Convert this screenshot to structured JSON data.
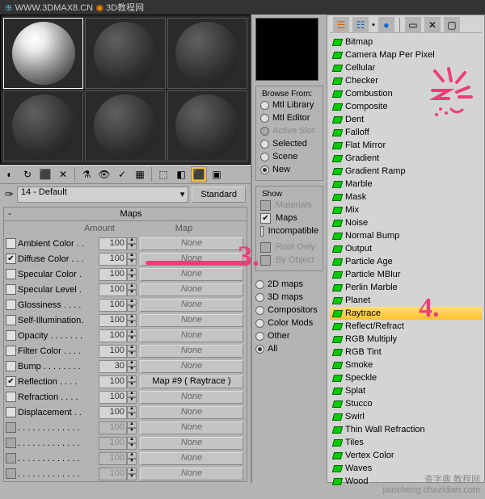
{
  "url_bar": {
    "domain": "WWW.3DMAX8.CN",
    "site_name": "3D教程网"
  },
  "toolbar_icons": [
    "◐",
    "↻",
    "⬛",
    "✕",
    "⚗",
    "👁",
    "✓",
    "▦",
    "⬚",
    "◧",
    "⬛",
    "▣"
  ],
  "material_picker": {
    "name": "14 - Default",
    "type_button": "Standard"
  },
  "maps_rollup": {
    "title": "Maps",
    "header_amount": "Amount",
    "header_map": "Map",
    "rows": [
      {
        "label": "Ambient Color . .",
        "amount": "100",
        "map": "None",
        "checked": false,
        "enabled": true
      },
      {
        "label": "Diffuse Color . . .",
        "amount": "100",
        "map": "None",
        "checked": true,
        "enabled": true
      },
      {
        "label": "Specular Color .",
        "amount": "100",
        "map": "None",
        "checked": false,
        "enabled": true
      },
      {
        "label": "Specular Level .",
        "amount": "100",
        "map": "None",
        "checked": false,
        "enabled": true
      },
      {
        "label": "Glossiness . . . .",
        "amount": "100",
        "map": "None",
        "checked": false,
        "enabled": true
      },
      {
        "label": "Self-Illumination.",
        "amount": "100",
        "map": "None",
        "checked": false,
        "enabled": true
      },
      {
        "label": "Opacity . . . . . . .",
        "amount": "100",
        "map": "None",
        "checked": false,
        "enabled": true
      },
      {
        "label": "Filter Color . . . .",
        "amount": "100",
        "map": "None",
        "checked": false,
        "enabled": true
      },
      {
        "label": "Bump . . . . . . . .",
        "amount": "30",
        "map": "None",
        "checked": false,
        "enabled": true
      },
      {
        "label": "Reflection . . . .",
        "amount": "100",
        "map": "Map #9 ( Raytrace )",
        "checked": true,
        "enabled": true
      },
      {
        "label": "Refraction . . . .",
        "amount": "100",
        "map": "None",
        "checked": false,
        "enabled": true
      },
      {
        "label": "Displacement . .",
        "amount": "100",
        "map": "None",
        "checked": false,
        "enabled": true
      },
      {
        "label": ". . . . . . . . . . . . .",
        "amount": "100",
        "map": "None",
        "checked": false,
        "enabled": false
      },
      {
        "label": ". . . . . . . . . . . . .",
        "amount": "100",
        "map": "None",
        "checked": false,
        "enabled": false
      },
      {
        "label": ". . . . . . . . . . . . .",
        "amount": "100",
        "map": "None",
        "checked": false,
        "enabled": false
      },
      {
        "label": ". . . . . . . . . . . . .",
        "amount": "100",
        "map": "None",
        "checked": false,
        "enabled": false
      }
    ]
  },
  "browse_from": {
    "legend": "Browse From:",
    "options": [
      {
        "label": "Mtl Library",
        "on": false,
        "dis": false
      },
      {
        "label": "Mtl Editor",
        "on": false,
        "dis": false
      },
      {
        "label": "Active Slot",
        "on": false,
        "dis": true
      },
      {
        "label": "Selected",
        "on": false,
        "dis": false
      },
      {
        "label": "Scene",
        "on": false,
        "dis": false
      },
      {
        "label": "New",
        "on": true,
        "dis": false
      }
    ]
  },
  "show": {
    "legend": "Show",
    "options": [
      {
        "label": "Materials",
        "dis": true
      },
      {
        "label": "Maps",
        "dis": false,
        "checked": true
      },
      {
        "label": "Incompatible",
        "dis": false
      }
    ],
    "options2": [
      {
        "label": "Root Only",
        "dis": true
      },
      {
        "label": "By Object",
        "dis": true
      }
    ]
  },
  "filter": {
    "options": [
      {
        "label": "2D maps",
        "on": false
      },
      {
        "label": "3D maps",
        "on": false
      },
      {
        "label": "Compositors",
        "on": false
      },
      {
        "label": "Color Mods",
        "on": false
      },
      {
        "label": "Other",
        "on": false
      },
      {
        "label": "All",
        "on": true
      }
    ]
  },
  "map_list": [
    "Bitmap",
    "Camera Map Per Pixel",
    "Cellular",
    "Checker",
    "Combustion",
    "Composite",
    "Dent",
    "Falloff",
    "Flat Mirror",
    "Gradient",
    "Gradient Ramp",
    "Marble",
    "Mask",
    "Mix",
    "Noise",
    "Normal Bump",
    "Output",
    "Particle Age",
    "Particle MBlur",
    "Perlin Marble",
    "Planet",
    "Raytrace",
    "Reflect/Refract",
    "RGB Multiply",
    "RGB Tint",
    "Smoke",
    "Speckle",
    "Splat",
    "Stucco",
    "Swirl",
    "Thin Wall Refraction",
    "Tiles",
    "Vertex Color",
    "Waves",
    "Wood"
  ],
  "map_list_selected": "Raytrace",
  "annotations": {
    "n3": "3.",
    "n4": "4."
  },
  "watermark": {
    "line1": "查字典 教程网",
    "line2": "jiaocheng.chazidian.com"
  }
}
